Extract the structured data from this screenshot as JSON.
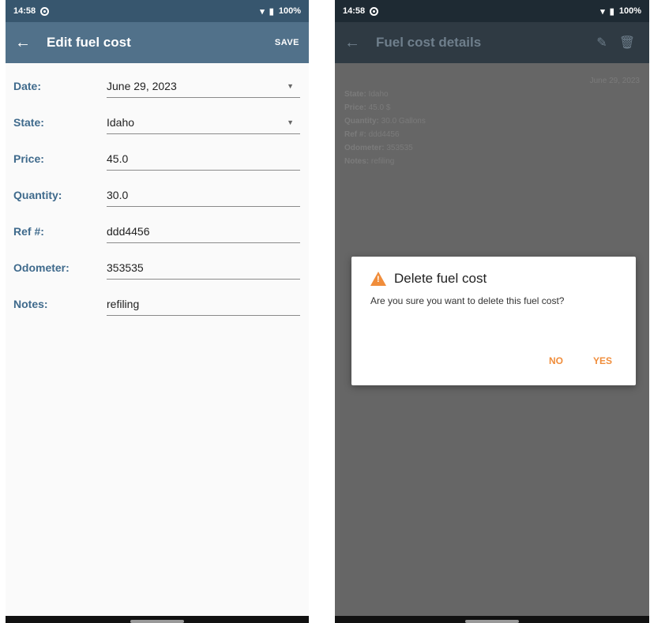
{
  "left": {
    "status": {
      "time": "14:58",
      "battery": "100%"
    },
    "appbar": {
      "back": "←",
      "title": "Edit fuel cost",
      "action": "SAVE"
    },
    "fields": [
      {
        "label": "Date:",
        "value": "June 29, 2023",
        "dropdown": true
      },
      {
        "label": "State:",
        "value": "Idaho",
        "dropdown": true
      },
      {
        "label": "Price:",
        "value": "45.0"
      },
      {
        "label": "Quantity:",
        "value": "30.0"
      },
      {
        "label": "Ref #:",
        "value": "ddd4456"
      },
      {
        "label": "Odometer:",
        "value": "353535"
      },
      {
        "label": "Notes:",
        "value": "refiling"
      }
    ]
  },
  "right": {
    "status": {
      "time": "14:58",
      "battery": "100%"
    },
    "appbar": {
      "back": "←",
      "title": "Fuel cost details",
      "edit": "✎",
      "delete": "🗑"
    },
    "details": {
      "date": "June 29, 2023",
      "state_label": "State:",
      "state": "Idaho",
      "price_label": "Price:",
      "price": "45.0 $",
      "quantity_label": "Quantity:",
      "quantity": "30.0 Gallons",
      "ref_label": "Ref #:",
      "ref": "ddd4456",
      "odometer_label": "Odometer:",
      "odometer": "353535",
      "notes_label": "Notes:",
      "notes": "refiling"
    },
    "dialog": {
      "title": "Delete fuel cost",
      "message": "Are you sure you want to delete this fuel cost?",
      "no": "NO",
      "yes": "YES"
    }
  },
  "colors": {
    "primary": "#51718a",
    "statusbar": "#37566e",
    "accent": "#f08d3b",
    "label": "#3f6a8c",
    "scrim": "#666666"
  }
}
